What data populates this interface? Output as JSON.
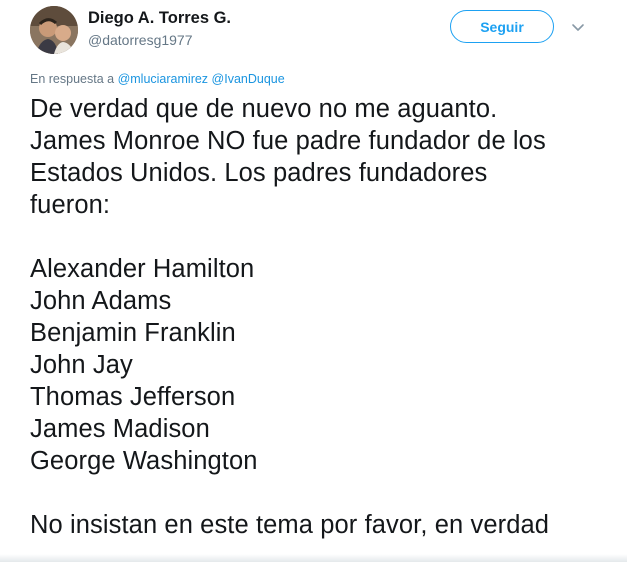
{
  "author": {
    "display_name": "Diego A. Torres G.",
    "handle": "@datorresg1977"
  },
  "follow_button": {
    "label": "Seguir"
  },
  "icons": {
    "menu": "chevron-down-icon",
    "avatar": "profile-photo"
  },
  "reply_context": {
    "prefix": "En respuesta a",
    "mentions": [
      "@mluciaramirez",
      "@IvanDuque"
    ]
  },
  "tweet": {
    "paragraph_1": [
      "De verdad que de nuevo no me aguanto.",
      "James Monroe NO fue padre fundador de los",
      "Estados Unidos. Los padres fundadores",
      "fueron:"
    ],
    "founders": [
      "Alexander Hamilton",
      "John Adams",
      "Benjamin Franklin",
      "John Jay",
      "Thomas Jefferson",
      "James Madison",
      "George Washington"
    ],
    "paragraph_3": [
      "No insistan en este tema por favor, en verdad"
    ]
  },
  "colors": {
    "accent": "#1da1f2",
    "mention": "#1b95e0",
    "muted": "#657786",
    "text": "#14171a"
  }
}
